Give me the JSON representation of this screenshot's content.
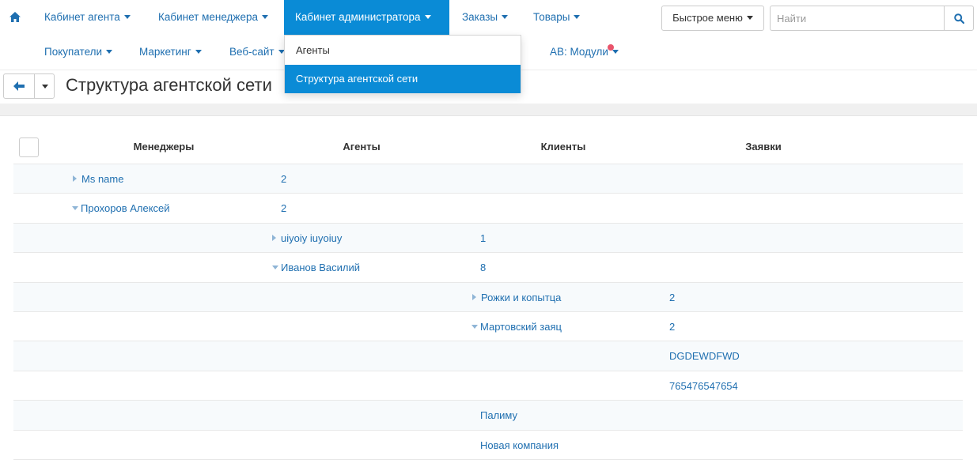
{
  "nav": {
    "row1": [
      {
        "label": "Кабинет агента"
      },
      {
        "label": "Кабинет менеджера"
      },
      {
        "label": "Кабинет администратора"
      },
      {
        "label": "Заказы"
      },
      {
        "label": "Товары"
      }
    ],
    "row2": [
      {
        "label": "Покупатели"
      },
      {
        "label": "Маркетинг"
      },
      {
        "label": "Веб-сайт"
      },
      {
        "label": "АВ: Модули"
      }
    ]
  },
  "quick_menu": {
    "label": "Быстрое меню"
  },
  "search": {
    "placeholder": "Найти",
    "value": ""
  },
  "dropdown": {
    "items": [
      {
        "label": "Агенты"
      },
      {
        "label": "Структура агентской сети"
      }
    ]
  },
  "page": {
    "title": "Структура агентской сети"
  },
  "table": {
    "headers": [
      "Менеджеры",
      "Агенты",
      "Клиенты",
      "Заявки"
    ],
    "rows": [
      {
        "manager": "Ms name",
        "agents_count": "2"
      },
      {
        "manager": "Прохоров Алексей",
        "agents_count": "2"
      },
      {
        "agent": "uiyoiy iuyoiuy",
        "clients_count": "1"
      },
      {
        "agent": "Иванов Василий",
        "clients_count": "8"
      },
      {
        "client": "Рожки и копытца",
        "orders_count": "2"
      },
      {
        "client": "Мартовский заяц",
        "orders_count": "2"
      },
      {
        "order": "DGDEWDFWD"
      },
      {
        "order": "765476547654"
      },
      {
        "client": "Палиму"
      },
      {
        "client": "Новая компания"
      }
    ]
  },
  "colors": {
    "accent": "#0a8bd6",
    "link": "#1f6fb0",
    "badge": "#e9546b"
  }
}
